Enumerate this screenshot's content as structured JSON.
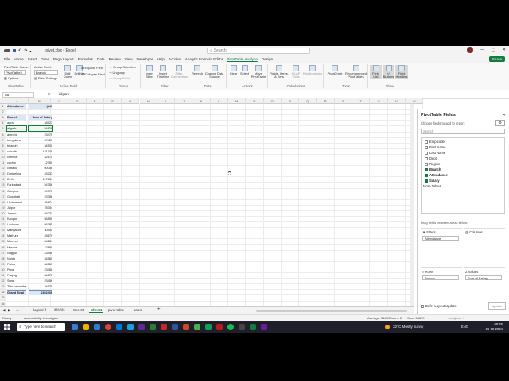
{
  "window": {
    "filename": "pivot.xlsx • Excel",
    "search_placeholder": "Search",
    "share_label": "Share"
  },
  "menu": [
    "File",
    "Home",
    "Insert",
    "Draw",
    "Page Layout",
    "Formulas",
    "Data",
    "Review",
    "View",
    "Developer",
    "Help",
    "Acrobat",
    "Analytic Formula Editor",
    "PivotTable Analyze",
    "Design"
  ],
  "menu_active": "PivotTable Analyze",
  "ribbon": {
    "pivottable": {
      "label": "PivotTable",
      "name_label": "PivotTable Name:",
      "name_value": "PivotTable3",
      "options": "Options"
    },
    "active_field": {
      "label": "Active Field",
      "field_label": "Active Field:",
      "field_value": "Branch",
      "settings": "Field Settings",
      "drill_down": "Drill Down",
      "drill_up": "Drill Up",
      "expand": "Expand Field",
      "collapse": "Collapse Field"
    },
    "group": {
      "label": "Group",
      "selection": "Group Selection",
      "ungroup": "Ungroup",
      "field": "Group Field"
    },
    "filter": {
      "label": "Filter",
      "slicer": "Insert Slicer",
      "timeline": "Insert Timeline",
      "connections": "Filter Connections"
    },
    "data": {
      "label": "Data",
      "refresh": "Refresh",
      "change_source": "Change Data Source"
    },
    "actions": {
      "label": "Actions",
      "clear": "Clear",
      "select": "Select",
      "move": "Move PivotTable"
    },
    "calculations": {
      "label": "Calculations",
      "fields_items": "Fields, Items, & Sets",
      "olap": "OLAP Tools",
      "relationships": "Relationships"
    },
    "tools": {
      "label": "Tools",
      "pivotchart": "PivotChart",
      "recommended": "Recommended PivotTables"
    },
    "show": {
      "label": "Show",
      "field_list": "Field List",
      "buttons": "+/- Buttons",
      "headers": "Field Headers"
    }
  },
  "formula": {
    "namebox": "A5",
    "fx": "fx",
    "value": "aligarh"
  },
  "columns": [
    "A",
    "B",
    "C",
    "D",
    "E",
    "F",
    "G",
    "H",
    "I",
    "J",
    "K",
    "L",
    "M",
    "N",
    "O",
    "P",
    "Q",
    "R",
    "S",
    "T",
    "U",
    "V",
    "W",
    "X",
    "Y",
    "Z"
  ],
  "pivot": {
    "filter_label": "Attendance",
    "filter_value": "(All)",
    "row_label": "Branch",
    "value_label": "Sum of Salary",
    "rows": [
      [
        "agra",
        "48923"
      ],
      [
        "aligarh",
        "54839"
      ],
      [
        "amroha",
        "23475"
      ],
      [
        "bengaluru",
        "67423"
      ],
      [
        "bhadohi",
        "34500"
      ],
      [
        "calcutta",
        "121345"
      ],
      [
        "chennai",
        "32675"
      ],
      [
        "cochin",
        "12790"
      ],
      [
        "cuttack",
        "60056"
      ],
      [
        "Darjeeling",
        "45237"
      ],
      [
        "Delhi",
        "117834"
      ],
      [
        "Faridabad",
        "54756"
      ],
      [
        "Gangtok",
        "20975"
      ],
      [
        "Guwahati",
        "23756"
      ],
      [
        "Hyderabad",
        "45674"
      ],
      [
        "Jaipur",
        "78304"
      ],
      [
        "Jammu",
        "65223"
      ],
      [
        "Kanpur",
        "56890"
      ],
      [
        "Lucknow",
        "56785"
      ],
      [
        "Mangalore",
        "30400"
      ],
      [
        "Mathura",
        "45679"
      ],
      [
        "Mumbai",
        "54234"
      ],
      [
        "Mysore",
        "42890"
      ],
      [
        "Nagpur",
        "43456"
      ],
      [
        "Noida",
        "34560"
      ],
      [
        "Patna",
        "34567"
      ],
      [
        "Pune",
        "23456"
      ],
      [
        "Prayag",
        "34675"
      ],
      [
        "Surat",
        "23456"
      ],
      [
        "Thiruvanantham",
        "34578"
      ]
    ],
    "total_label": "Grand Total",
    "total_value": "1392406"
  },
  "pane": {
    "title": "PivotTable Fields",
    "subtitle": "Choose fields to add to report:",
    "search_placeholder": "Search",
    "fields": [
      {
        "name": "Emp code",
        "checked": false
      },
      {
        "name": "First Name",
        "checked": false
      },
      {
        "name": "Last Name",
        "checked": false
      },
      {
        "name": "Dept",
        "checked": false
      },
      {
        "name": "Region",
        "checked": false
      },
      {
        "name": "Branch",
        "checked": true
      },
      {
        "name": "Attendance",
        "checked": true
      },
      {
        "name": "Salary",
        "checked": true
      }
    ],
    "more_tables": "More Tables...",
    "drag_label": "Drag fields between areas below:",
    "filters_label": "Filters",
    "filters_value": "Attendance",
    "columns_label": "Columns",
    "rows_label": "Rows",
    "rows_value": "Branch",
    "values_label": "Values",
    "values_value": "Sum of Salary",
    "defer_label": "Defer Layout Update",
    "update_label": "Update"
  },
  "sheets": [
    "logical if",
    "if/ifs/ifs",
    "Sheet5",
    "Sheet1",
    "pivot table",
    "sales"
  ],
  "active_sheet": "Sheet1",
  "status": {
    "left": "Ready",
    "accessibility": "Accessibility: Investigate",
    "average": "Average: 54839",
    "count": "Count: 2",
    "sum": "Sum: 54839"
  },
  "taskbar": {
    "search": "Type here to search",
    "weather": "32°C  Mostly sunny",
    "time": "08:45",
    "date": "26-08-2024",
    "lang": "ENG"
  },
  "colors": {
    "excel_green": "#107c41",
    "pivot_header": "#dde7f3",
    "taskbar": "#1f1f2a"
  },
  "icons": [
    "save-icon",
    "undo-icon",
    "redo-icon",
    "search-icon",
    "close-icon",
    "gear-icon",
    "windows-start-icon"
  ]
}
